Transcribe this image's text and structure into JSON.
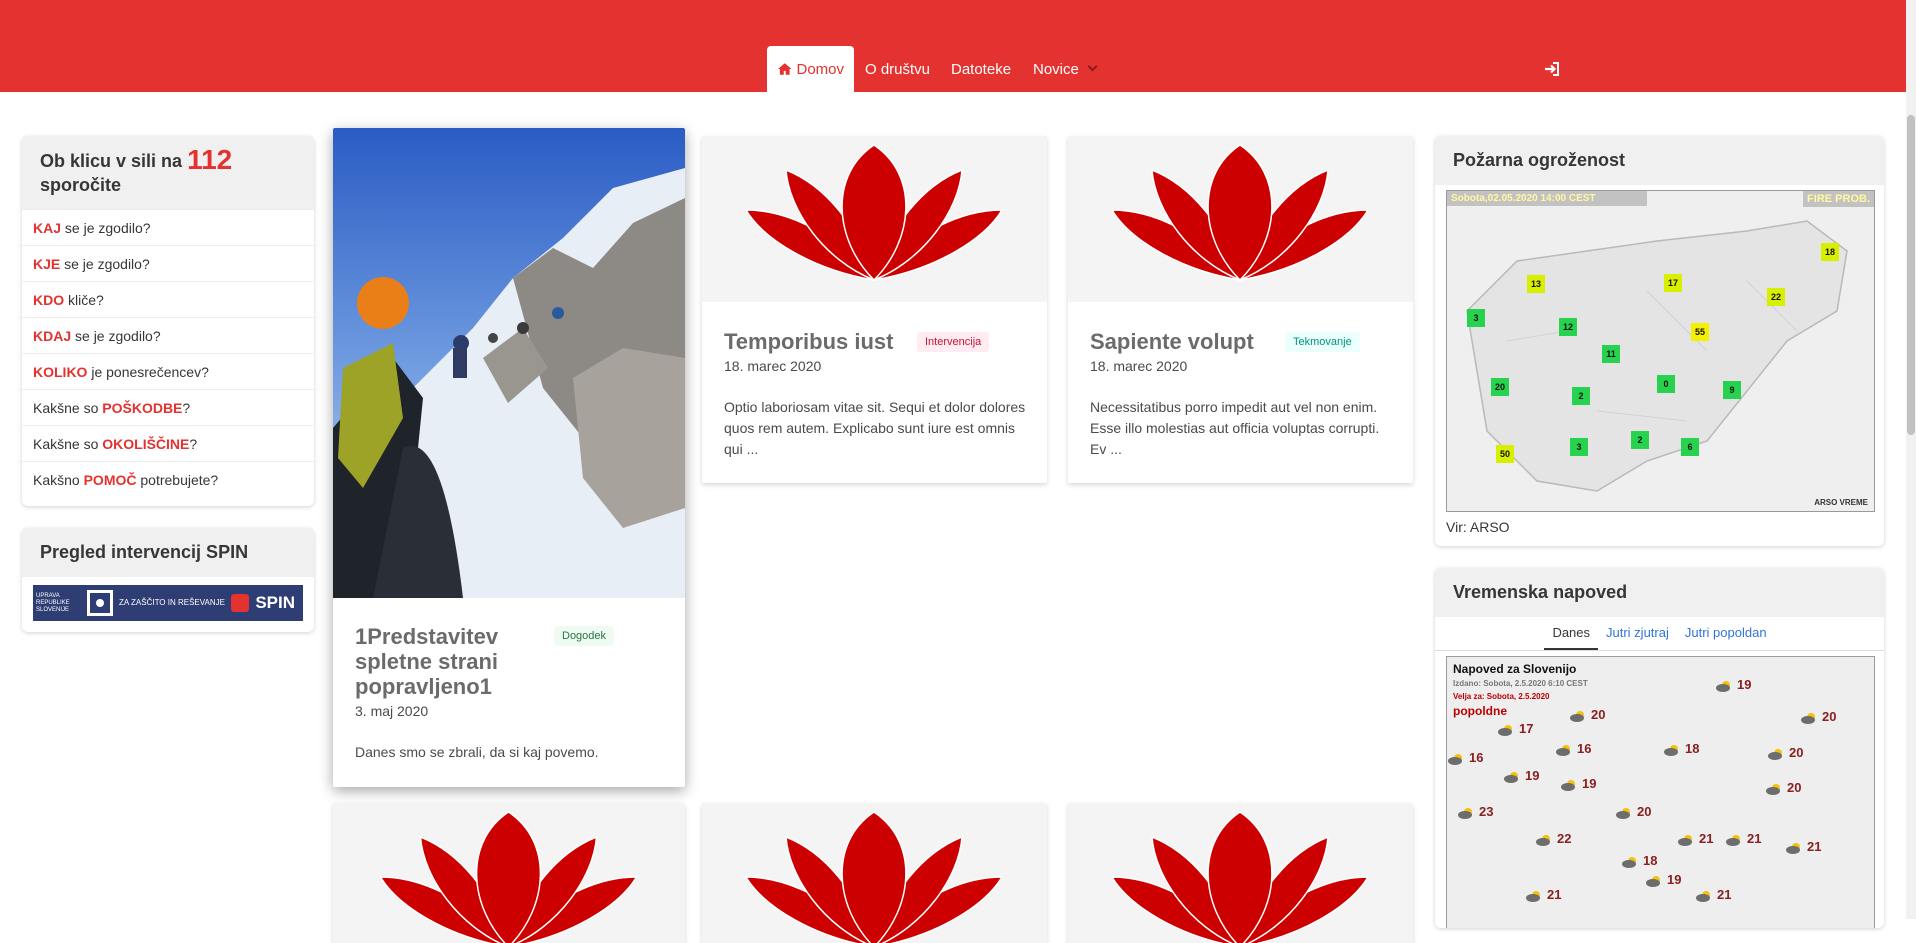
{
  "nav": {
    "items": [
      {
        "label": "Domov",
        "icon": "home-icon"
      },
      {
        "label": "O društvu"
      },
      {
        "label": "Datoteke"
      },
      {
        "label": "Novice",
        "icon": "chevron-down-icon"
      }
    ],
    "login_icon": "sign-in-icon"
  },
  "emergency": {
    "title_prefix": "Ob klicu v sili na",
    "number": "112",
    "title_suffix": "sporočite",
    "items": [
      {
        "pre": "",
        "highlight": "KAJ",
        "post": " se je zgodilo?"
      },
      {
        "pre": "",
        "highlight": "KJE",
        "post": " se je zgodilo?"
      },
      {
        "pre": "",
        "highlight": "KDO",
        "post": " kliče?"
      },
      {
        "pre": "",
        "highlight": "KDAJ",
        "post": " se je zgodilo?"
      },
      {
        "pre": "",
        "highlight": "KOLIKO",
        "post": " je ponesrečencev?"
      },
      {
        "pre": "Kakšne so ",
        "highlight": "POŠKODBE",
        "post": "?"
      },
      {
        "pre": "Kakšne so ",
        "highlight": "OKOLIŠČINE",
        "post": "?"
      },
      {
        "pre": "Kakšno ",
        "highlight": "POMOČ",
        "post": " potrebujete?"
      }
    ]
  },
  "spin": {
    "title": "Pregled intervencij SPIN",
    "banner_left": "UPRAVA REPUBLIKE SLOVENIJE",
    "banner_mid": "ZA ZAŠČITO IN REŠEVANJE",
    "banner_right": "SPIN"
  },
  "posts": [
    {
      "title": "1Predstavitev spletne strani popravljeno1",
      "tag": "Dogodek",
      "date": "3. maj 2020",
      "excerpt": "Danes smo se zbrali, da si kaj povemo."
    },
    {
      "title": "Temporibus iust",
      "tag": "Intervencija",
      "date": "18. marec 2020",
      "excerpt": "Optio laboriosam vitae sit. Sequi et dolor dolores quos rem autem. Explicabo sunt iure est omnis qui ..."
    },
    {
      "title": "Sapiente volupt",
      "tag": "Tekmovanje",
      "date": "18. marec 2020",
      "excerpt": "Necessitatibus porro impedit aut vel non enim. Esse illo molestias aut officia voluptas corrupti. Ev ..."
    }
  ],
  "fire": {
    "title": "Požarna ogroženost",
    "map_date": "Sobota,02.05.2020 14:00 CEST",
    "map_label": "FIRE PROB.",
    "map_brand": "ARSO VREME",
    "source": "Vir: ARSO",
    "values": [
      {
        "v": "18",
        "level": "yellow"
      },
      {
        "v": "13",
        "level": "yellow"
      },
      {
        "v": "17",
        "level": "yellow"
      },
      {
        "v": "22",
        "level": "yellow"
      },
      {
        "v": "3",
        "level": "green"
      },
      {
        "v": "12",
        "level": "green"
      },
      {
        "v": "55",
        "level": "yellow2"
      },
      {
        "v": "11",
        "level": "green"
      },
      {
        "v": "20",
        "level": "green"
      },
      {
        "v": "2",
        "level": "green"
      },
      {
        "v": "0",
        "level": "green"
      },
      {
        "v": "9",
        "level": "green"
      },
      {
        "v": "50",
        "level": "yellow"
      },
      {
        "v": "3",
        "level": "green"
      },
      {
        "v": "2",
        "level": "green"
      },
      {
        "v": "6",
        "level": "green"
      }
    ]
  },
  "weather": {
    "title": "Vremenska napoved",
    "tabs": [
      "Danes",
      "Jutri zjutraj",
      "Jutri popoldan"
    ],
    "map_title": "Napoved za Slovenijo",
    "issued": "Izdano: Sobota, 2.5.2020 6:10 CEST",
    "valid": "Velja za: Sobota, 2.5.2020",
    "period": "popoldne",
    "temps": [
      "19",
      "20",
      "20",
      "17",
      "16",
      "18",
      "20",
      "16",
      "19",
      "19",
      "20",
      "23",
      "20",
      "22",
      "18",
      "21",
      "21",
      "21",
      "19",
      "21",
      "21"
    ]
  },
  "colors": {
    "brand": "#e3322f",
    "dogodek": "#257942",
    "intervencija": "#cc0f35",
    "tekmovanje": "#00947e"
  }
}
